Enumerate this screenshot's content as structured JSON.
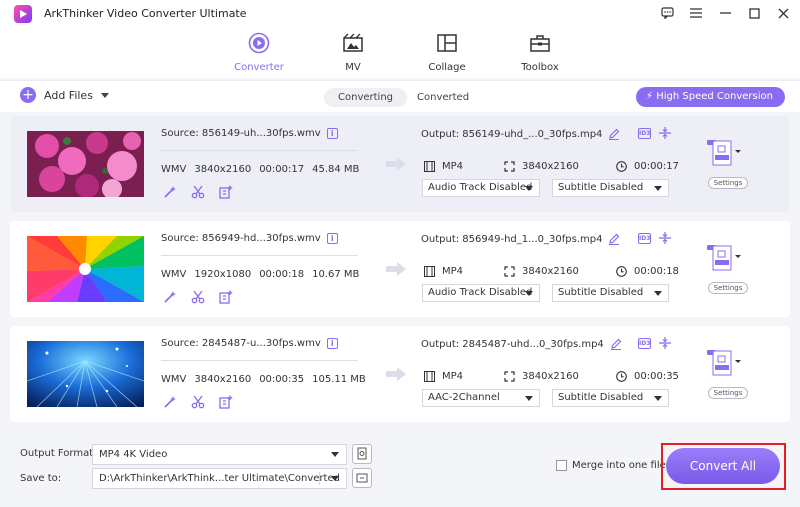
{
  "app": {
    "title": "ArkThinker Video Converter Ultimate"
  },
  "colors": {
    "accent": "#8a6cf0",
    "highlight": "#e02020"
  },
  "window_controls": [
    {
      "name": "feedback-icon",
      "glyph": "☐"
    },
    {
      "name": "menu-icon",
      "glyph": "≡"
    },
    {
      "name": "minimize-icon",
      "glyph": "—"
    },
    {
      "name": "maximize-icon",
      "glyph": "☐"
    },
    {
      "name": "close-icon",
      "glyph": "✕"
    }
  ],
  "nav": {
    "tabs": [
      {
        "label": "Converter",
        "icon": "converter-icon",
        "active": true
      },
      {
        "label": "MV",
        "icon": "mv-icon",
        "active": false
      },
      {
        "label": "Collage",
        "icon": "collage-icon",
        "active": false
      },
      {
        "label": "Toolbox",
        "icon": "toolbox-icon",
        "active": false
      }
    ]
  },
  "toolbar": {
    "add_files": "Add Files",
    "seg_converting": "Converting",
    "seg_converted": "Converted",
    "high_speed": "High Speed Conversion"
  },
  "files": [
    {
      "source": "Source: 856149-uh...30fps.wmv",
      "format": "WMV",
      "resolution": "3840x2160",
      "duration": "00:00:17",
      "size": "45.84 MB",
      "output": "Output: 856149-uhd_...0_30fps.mp4",
      "out_format": "MP4",
      "out_resolution": "3840x2160",
      "out_duration": "00:00:17",
      "audio": "Audio Track Disabled",
      "subtitle": "Subtitle Disabled",
      "settings": "Settings",
      "selected": true
    },
    {
      "source": "Source: 856949-hd...30fps.wmv",
      "format": "WMV",
      "resolution": "1920x1080",
      "duration": "00:00:18",
      "size": "10.67 MB",
      "output": "Output: 856949-hd_1...0_30fps.mp4",
      "out_format": "MP4",
      "out_resolution": "3840x2160",
      "out_duration": "00:00:18",
      "audio": "Audio Track Disabled",
      "subtitle": "Subtitle Disabled",
      "settings": "Settings",
      "selected": false
    },
    {
      "source": "Source: 2845487-u...30fps.wmv",
      "format": "WMV",
      "resolution": "3840x2160",
      "duration": "00:00:35",
      "size": "105.11 MB",
      "output": "Output: 2845487-uhd...0_30fps.mp4",
      "out_format": "MP4",
      "out_resolution": "3840x2160",
      "out_duration": "00:00:35",
      "audio": "AAC-2Channel",
      "subtitle": "Subtitle Disabled",
      "settings": "Settings",
      "selected": false
    }
  ],
  "bottom": {
    "output_format_label": "Output Format:",
    "output_format_value": "MP4 4K Video",
    "save_to_label": "Save to:",
    "save_to_value": "D:\\ArkThinker\\ArkThink...ter Ultimate\\Converted",
    "merge_label": "Merge into one file",
    "convert_all": "Convert All"
  }
}
